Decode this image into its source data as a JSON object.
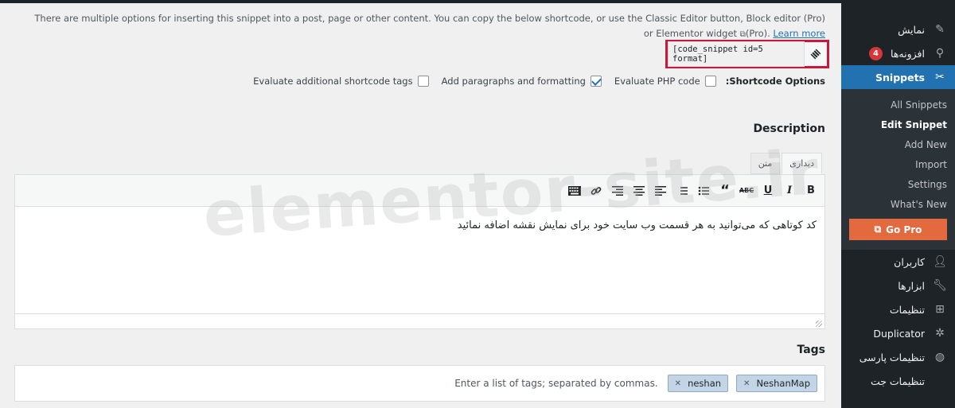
{
  "intro": {
    "text": "There are multiple options for inserting this snippet into a post, page or other content. You can copy the below shortcode, or use the Classic Editor button, Block editor (Pro) or Elementor widget",
    "suffix": "(Pro).",
    "link": "Learn more"
  },
  "shortcode": {
    "value": "[code_snippet id=5 format]",
    "icon": "snippet-icon"
  },
  "shortcode_options": {
    "label": "Shortcode Options:",
    "options": [
      {
        "label": "Evaluate PHP code",
        "checked": false
      },
      {
        "label": "Add paragraphs and formatting",
        "checked": true
      },
      {
        "label": "Evaluate additional shortcode tags",
        "checked": false
      }
    ]
  },
  "description": {
    "title": "Description",
    "tabs": [
      "دیداری",
      "متن"
    ],
    "toolbar": [
      "B",
      "I",
      "U",
      "ABC",
      "“",
      "list",
      "numlist",
      "align-left",
      "align-center",
      "align-right",
      "link",
      "keyboard"
    ],
    "content": "کد کوتاهی که می‌توانید به هر قسمت وب سایت خود برای نمایش نقشه اضافه نمائید"
  },
  "tags": {
    "title": "Tags",
    "items": [
      "NeshanMap",
      "neshan"
    ],
    "placeholder": "Enter a list of tags; separated by commas."
  },
  "watermark": "elementor-site.ir",
  "sidebar": {
    "items_top": [
      {
        "label": "نمایش",
        "icon": "brush-icon"
      },
      {
        "label": "افزونه‌ها",
        "icon": "plugin-icon",
        "badge": "4"
      },
      {
        "label": "Snippets",
        "icon": "scissors-icon",
        "active": true
      }
    ],
    "submenu": [
      {
        "label": "All Snippets"
      },
      {
        "label": "Edit Snippet",
        "current": true
      },
      {
        "label": "Add New"
      },
      {
        "label": "Import"
      },
      {
        "label": "Settings"
      },
      {
        "label": "What's New"
      }
    ],
    "go_pro": "Go Pro",
    "items_bottom": [
      {
        "label": "کاربران",
        "icon": "user-icon"
      },
      {
        "label": "ابزارها",
        "icon": "wrench-icon"
      },
      {
        "label": "تنظیمات",
        "icon": "settings-icon"
      },
      {
        "label": "Duplicator",
        "icon": "duplicator-icon"
      },
      {
        "label": "تنظیمات پارسی",
        "icon": "globe-icon"
      },
      {
        "label": "تنظیمات جت",
        "icon": "jet-icon"
      }
    ]
  },
  "colors": {
    "accent": "#2271b1",
    "highlight_border": "#c9183c",
    "sidebar_bg": "#1d2327",
    "gopro": "#e3693e"
  }
}
